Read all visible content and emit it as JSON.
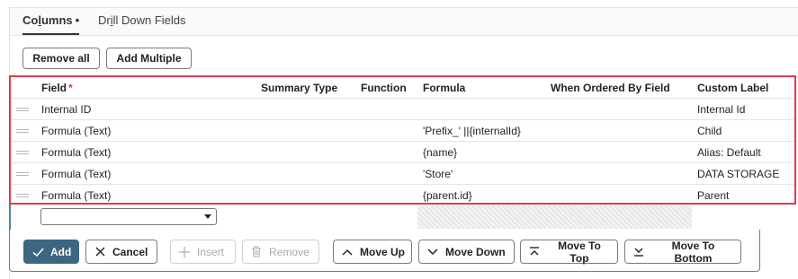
{
  "tabs": [
    {
      "label_first": "Co",
      "label_underlined": "l",
      "label_rest": "umns",
      "dot": "•"
    },
    {
      "label_first": "Dr",
      "label_underlined": "i",
      "label_rest": "ll Down Fields"
    }
  ],
  "toolbar": {
    "remove_all": "Remove all",
    "add_multiple": "Add Multiple"
  },
  "table": {
    "headers": {
      "field": "Field",
      "required_mark": "*",
      "summary_type": "Summary Type",
      "function": "Function",
      "formula": "Formula",
      "when_ordered_by_field": "When Ordered By Field",
      "custom_label": "Custom Label"
    },
    "rows": [
      {
        "field": "Internal ID",
        "formula": "",
        "custom_label": "Internal Id"
      },
      {
        "field": "Formula (Text)",
        "formula": "'Prefix_' ||{internalId}",
        "custom_label": "Child"
      },
      {
        "field": "Formula (Text)",
        "formula": "{name}",
        "custom_label": "Alias: Default"
      },
      {
        "field": "Formula (Text)",
        "formula": "'Store'",
        "custom_label": "DATA STORAGE"
      },
      {
        "field": "Formula (Text)",
        "formula": "{parent.id}",
        "custom_label": "Parent"
      }
    ]
  },
  "edit_row": {
    "field_value": ""
  },
  "actions": {
    "add": "Add",
    "cancel": "Cancel",
    "insert": "Insert",
    "remove": "Remove",
    "move_up": "Move Up",
    "move_down": "Move Down",
    "move_to_top": "Move To Top",
    "move_to_bottom": "Move To Bottom"
  },
  "colors": {
    "accent": "#3c6682",
    "highlight_border": "#e03a48",
    "edit_border": "#4d87a8"
  }
}
